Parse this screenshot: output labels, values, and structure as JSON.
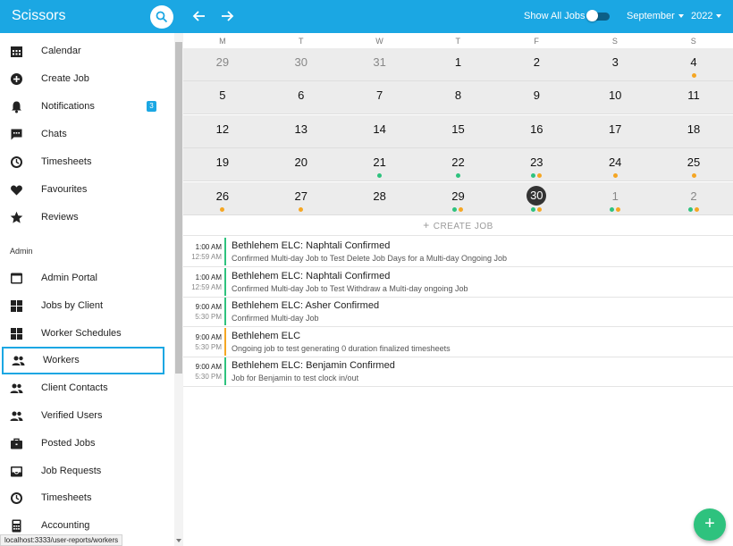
{
  "app": {
    "title": "Scissors"
  },
  "header": {
    "show_all_label": "Show All Jobs",
    "month": "September",
    "year": "2022"
  },
  "colors": {
    "primary": "#1ba7e3",
    "green": "#2ec27e",
    "orange": "#f5a623",
    "today": "#333333"
  },
  "sidebar": {
    "items": [
      {
        "label": "Calendar",
        "icon": "calendar-icon"
      },
      {
        "label": "Create Job",
        "icon": "add-circle-icon"
      },
      {
        "label": "Notifications",
        "icon": "bell-icon",
        "badge": "3"
      },
      {
        "label": "Chats",
        "icon": "chat-icon"
      },
      {
        "label": "Timesheets",
        "icon": "clock-icon"
      },
      {
        "label": "Favourites",
        "icon": "heart-icon"
      },
      {
        "label": "Reviews",
        "icon": "star-icon"
      }
    ],
    "admin_header": "Admin",
    "admin_items": [
      {
        "label": "Admin Portal",
        "icon": "window-icon"
      },
      {
        "label": "Jobs by Client",
        "icon": "grid-icon"
      },
      {
        "label": "Worker Schedules",
        "icon": "grid-icon"
      },
      {
        "label": "Workers",
        "icon": "people-icon",
        "active": true
      },
      {
        "label": "Client Contacts",
        "icon": "people-icon"
      },
      {
        "label": "Verified Users",
        "icon": "people-icon"
      },
      {
        "label": "Posted Jobs",
        "icon": "briefcase-icon"
      },
      {
        "label": "Job Requests",
        "icon": "inbox-icon"
      },
      {
        "label": "Timesheets",
        "icon": "clock-icon"
      },
      {
        "label": "Accounting",
        "icon": "calculator-icon"
      }
    ]
  },
  "status_url": "localhost:3333/user-reports/workers",
  "calendar": {
    "weekdays": [
      "M",
      "T",
      "W",
      "T",
      "F",
      "S",
      "S"
    ],
    "weeks": [
      [
        {
          "d": "29",
          "muted": true,
          "dots": []
        },
        {
          "d": "30",
          "muted": true,
          "dots": []
        },
        {
          "d": "31",
          "muted": true,
          "dots": []
        },
        {
          "d": "1",
          "dots": []
        },
        {
          "d": "2",
          "dots": []
        },
        {
          "d": "3",
          "dots": []
        },
        {
          "d": "4",
          "dots": [
            "orange"
          ]
        }
      ],
      [
        {
          "d": "5",
          "dots": []
        },
        {
          "d": "6",
          "dots": []
        },
        {
          "d": "7",
          "dots": []
        },
        {
          "d": "8",
          "dots": []
        },
        {
          "d": "9",
          "dots": []
        },
        {
          "d": "10",
          "dots": []
        },
        {
          "d": "11",
          "dots": []
        }
      ],
      [
        {
          "d": "12",
          "dots": []
        },
        {
          "d": "13",
          "dots": []
        },
        {
          "d": "14",
          "dots": []
        },
        {
          "d": "15",
          "dots": []
        },
        {
          "d": "16",
          "dots": []
        },
        {
          "d": "17",
          "dots": []
        },
        {
          "d": "18",
          "dots": []
        }
      ],
      [
        {
          "d": "19",
          "dots": []
        },
        {
          "d": "20",
          "dots": []
        },
        {
          "d": "21",
          "dots": [
            "green"
          ]
        },
        {
          "d": "22",
          "dots": [
            "green"
          ]
        },
        {
          "d": "23",
          "dots": [
            "green",
            "orange"
          ]
        },
        {
          "d": "24",
          "dots": [
            "orange"
          ]
        },
        {
          "d": "25",
          "dots": [
            "orange"
          ]
        }
      ],
      [
        {
          "d": "26",
          "dots": [
            "orange"
          ]
        },
        {
          "d": "27",
          "dots": [
            "orange"
          ]
        },
        {
          "d": "28",
          "dots": []
        },
        {
          "d": "29",
          "dots": [
            "green",
            "orange"
          ]
        },
        {
          "d": "30",
          "today": true,
          "dots": [
            "green",
            "orange"
          ]
        },
        {
          "d": "1",
          "muted": true,
          "dots": [
            "green",
            "orange"
          ]
        },
        {
          "d": "2",
          "muted": true,
          "dots": [
            "green",
            "orange"
          ]
        }
      ]
    ],
    "create_job_label": "CREATE JOB"
  },
  "jobs": [
    {
      "start": "1:00 AM",
      "end": "12:59 AM",
      "title": "Bethlehem ELC: Naphtali Confirmed",
      "desc": "Confirmed Multi-day Job to Test Delete Job Days for a Multi-day Ongoing Job",
      "color": "green"
    },
    {
      "start": "1:00 AM",
      "end": "12:59 AM",
      "title": "Bethlehem ELC: Naphtali Confirmed",
      "desc": "Confirmed Multi-day Job to Test Withdraw a Multi-day ongoing Job",
      "color": "green"
    },
    {
      "start": "9:00 AM",
      "end": "5:30 PM",
      "title": "Bethlehem ELC: Asher Confirmed",
      "desc": "Confirmed Multi-day Job",
      "color": "green"
    },
    {
      "start": "9:00 AM",
      "end": "5:30 PM",
      "title": "Bethlehem ELC",
      "desc": "Ongoing job to test generating 0 duration finalized timesheets",
      "color": "orange"
    },
    {
      "start": "9:00 AM",
      "end": "5:30 PM",
      "title": "Bethlehem ELC: Benjamin Confirmed",
      "desc": "Job for Benjamin to test clock in/out",
      "color": "green"
    }
  ],
  "fab_label": "+"
}
